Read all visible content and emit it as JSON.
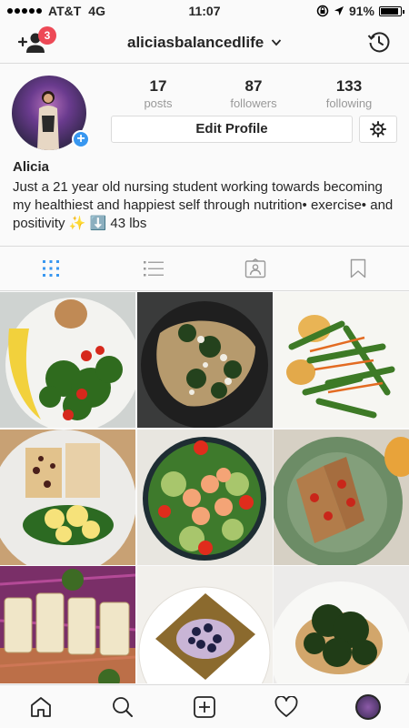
{
  "status_bar": {
    "carrier": "AT&T",
    "network": "4G",
    "time": "11:07",
    "battery": "91%",
    "battery_level": 0.91,
    "icons": [
      "signal-dots-icon",
      "rotation-lock-icon",
      "location-arrow-icon",
      "battery-icon"
    ]
  },
  "nav": {
    "username": "aliciasbalancedlife",
    "notification_count": "3",
    "left_icon": "add-person-icon",
    "right_icon": "history-icon",
    "dropdown_icon": "chevron-down-icon"
  },
  "profile": {
    "stats": [
      {
        "value": "17",
        "label": "posts"
      },
      {
        "value": "87",
        "label": "followers"
      },
      {
        "value": "133",
        "label": "following"
      }
    ],
    "edit_label": "Edit Profile",
    "settings_icon": "gear-icon",
    "name": "Alicia",
    "bio": "Just a 21 year old nursing student working towards becoming my healthiest and happiest self through nutrition• exercise• and positivity ✨ ⬇️ 43 lbs"
  },
  "tabs": [
    {
      "icon": "grid-icon",
      "active": true
    },
    {
      "icon": "list-icon",
      "active": false
    },
    {
      "icon": "tagged-photos-icon",
      "active": false
    },
    {
      "icon": "bookmark-icon",
      "active": false
    }
  ],
  "posts": [
    {
      "subject": "banana, kale, tomatoes and peanut butter"
    },
    {
      "subject": "chicken with spinach in a skillet"
    },
    {
      "subject": "green beans with carrots and cauliflower"
    },
    {
      "subject": "rice cakes with eggs and kale"
    },
    {
      "subject": "shrimp salad with tomatoes"
    },
    {
      "subject": "toast with tomatoes on a plate"
    },
    {
      "subject": "halloumi over purple cabbage"
    },
    {
      "subject": "toast with blueberries"
    },
    {
      "subject": "spinach over bread"
    }
  ],
  "bottom_bar": [
    "home-icon",
    "search-icon",
    "new-post-icon",
    "heart-icon",
    "profile-icon"
  ],
  "colors": {
    "accent": "#3897f0",
    "badge": "#ed4956",
    "text": "#262626",
    "muted": "#999999",
    "border": "#dbdbdb"
  }
}
